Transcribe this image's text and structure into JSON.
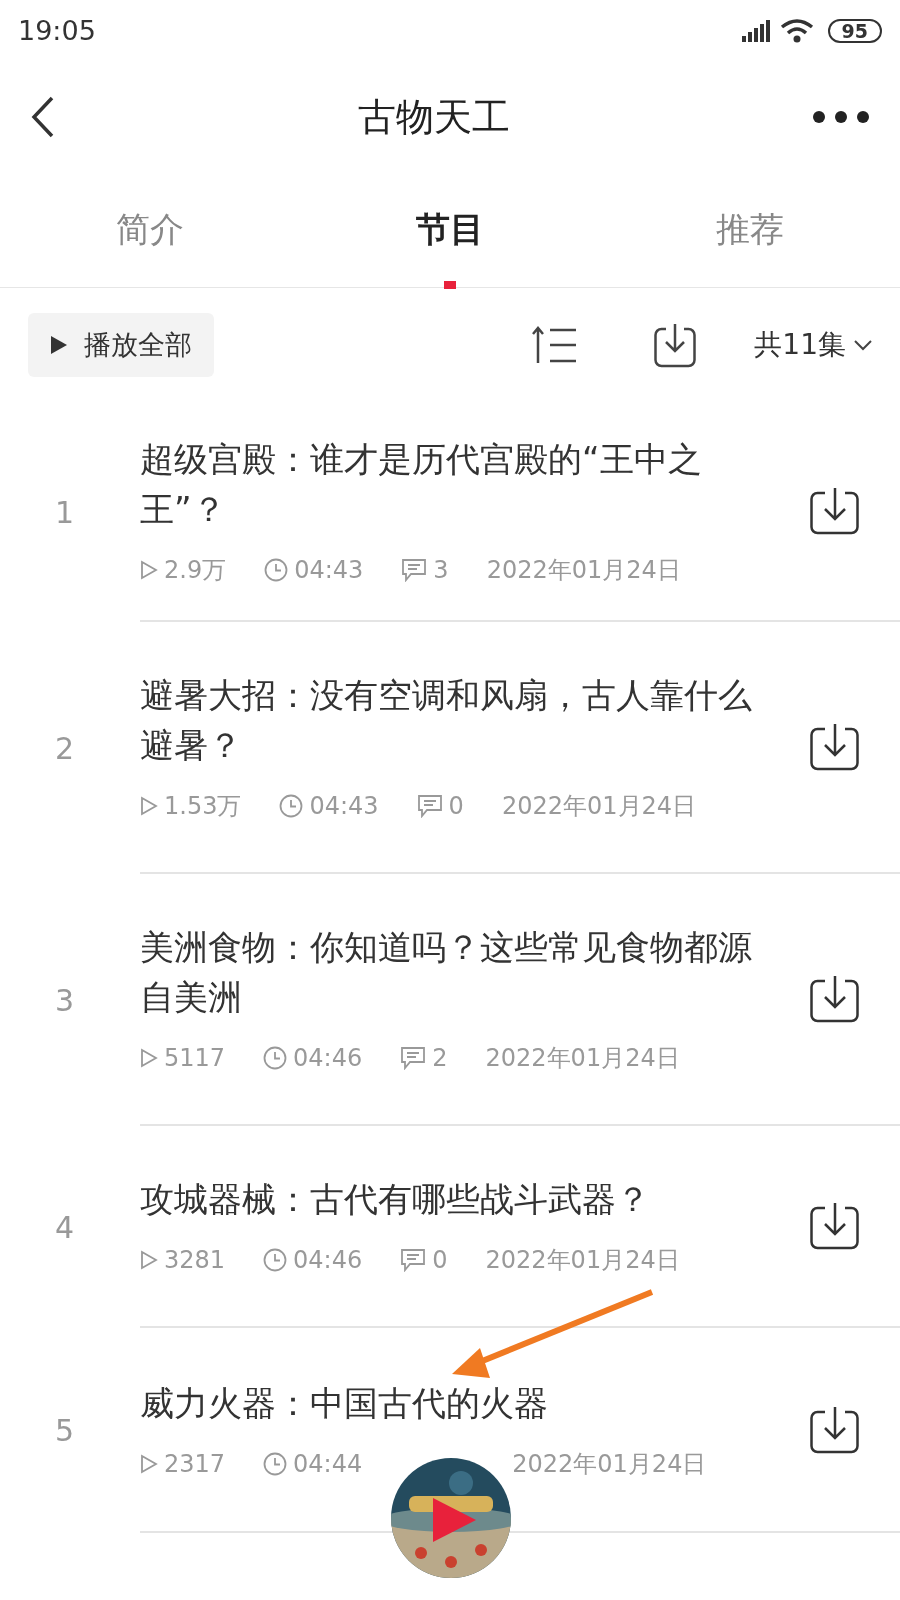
{
  "status_bar": {
    "time": "19:05",
    "battery": "95"
  },
  "header": {
    "title": "古物天工"
  },
  "tabs": [
    {
      "label": "简介",
      "selected": false
    },
    {
      "label": "节目",
      "selected": true
    },
    {
      "label": "推荐",
      "selected": false
    }
  ],
  "toolbar": {
    "play_all": "播放全部",
    "count": "共11集"
  },
  "episodes": [
    {
      "index": "1",
      "title": "超级宫殿：谁才是历代宫殿的“王中之王”？",
      "plays": "2.9万",
      "duration": "04:43",
      "comments": "3",
      "date": "2022年01月24日"
    },
    {
      "index": "2",
      "title": "避暑大招：没有空调和风扇，古人靠什么避暑？",
      "plays": "1.53万",
      "duration": "04:43",
      "comments": "0",
      "date": "2022年01月24日"
    },
    {
      "index": "3",
      "title": "美洲食物：你知道吗？这些常见食物都源自美洲",
      "plays": "5117",
      "duration": "04:46",
      "comments": "2",
      "date": "2022年01月24日"
    },
    {
      "index": "4",
      "title": "攻城器械：古代有哪些战斗武器？",
      "plays": "3281",
      "duration": "04:46",
      "comments": "0",
      "date": "2022年01月24日"
    },
    {
      "index": "5",
      "title": "威力火器：中国古代的火器",
      "plays": "2317",
      "duration": "04:44",
      "date": "2022年01月24日"
    }
  ]
}
